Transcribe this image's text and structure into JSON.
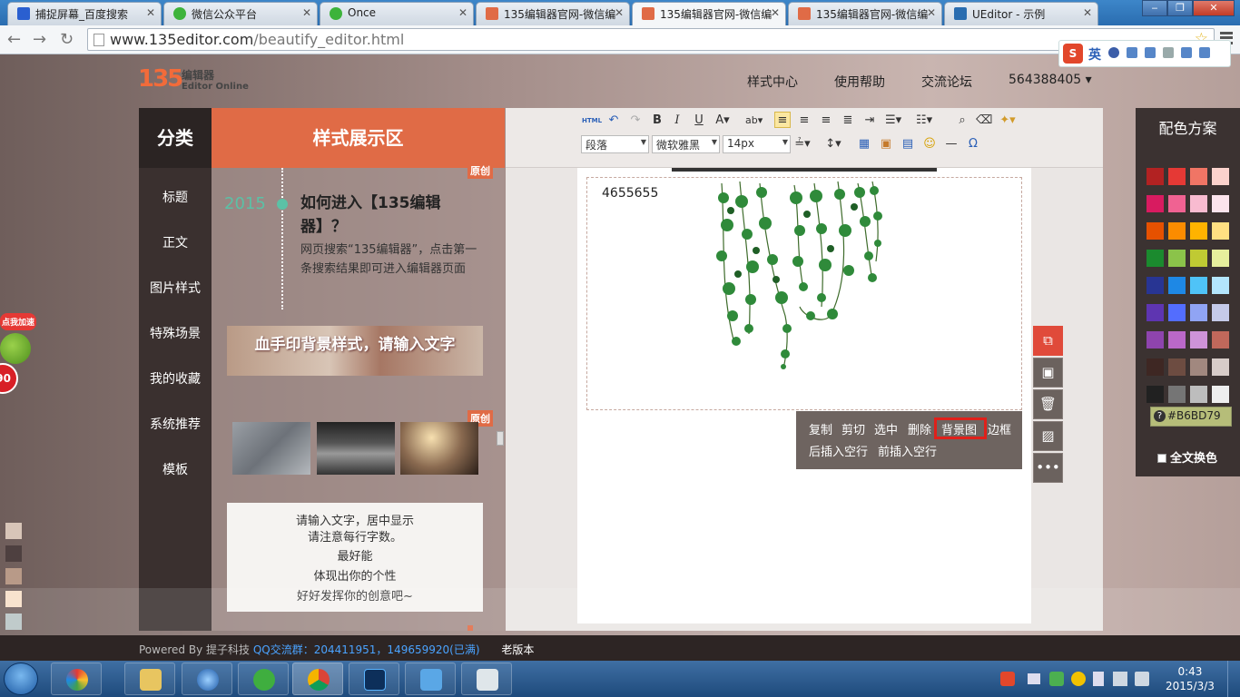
{
  "browser": {
    "tabs": [
      {
        "label": "捕捉屏幕_百度搜索",
        "fav": "#2a5fd0"
      },
      {
        "label": "微信公众平台",
        "fav": "#3db33b"
      },
      {
        "label": "Once",
        "fav": "#3db33b"
      },
      {
        "label": "135编辑器官网-微信编",
        "fav": "#e06b46"
      },
      {
        "label": "135编辑器官网-微信编",
        "fav": "#e06b46"
      },
      {
        "label": "135编辑器官网-微信编",
        "fav": "#e06b46"
      },
      {
        "label": "UEditor - 示例",
        "fav": "#2a6db0"
      }
    ],
    "url_host": "www.135editor.com",
    "url_path": "/beautify_editor.html",
    "ime": "英"
  },
  "site": {
    "logo_num": "135",
    "logo_cn": "编辑器",
    "logo_en": "Editor Online",
    "nav": [
      "样式中心",
      "使用帮助",
      "交流论坛",
      "564388405 ▾"
    ]
  },
  "categories": {
    "title": "分类",
    "items": [
      "标题",
      "正文",
      "图片样式",
      "特殊场景",
      "我的收藏",
      "系统推荐",
      "模板"
    ]
  },
  "styles": {
    "title": "样式展示区",
    "timeline_year": "2015",
    "timeline_heading": "如何进入【135编辑器】？",
    "timeline_body": "网页搜索“135编辑器”，点击第一条搜索结果即可进入编辑器页面",
    "badge": "原创",
    "banner_text": "血手印背景样式，请输入文字",
    "textbox_lines": [
      "请输入文字，居中显示",
      "请注意每行字数。",
      "最好能",
      "体现出你的个性",
      "好好发挥你的创意吧~"
    ]
  },
  "toolbar": {
    "paragraph": "段落",
    "font": "微软雅黑",
    "size": "14px"
  },
  "editor": {
    "content": "4655655"
  },
  "context_menu": {
    "copy": "复制",
    "cut": "剪切",
    "select": "选中",
    "delete": "删除",
    "background": "背景图",
    "border": "边框",
    "insert_after": "后插入空行",
    "insert_before": "前插入空行"
  },
  "color_scheme": {
    "title": "配色方案",
    "hex": "#B6BD79",
    "full_text_label": "全文换色",
    "swatches": [
      "#b22222",
      "#e53935",
      "#f07565",
      "#fbd2cc",
      "#d81b60",
      "#f06292",
      "#f8bbd0",
      "#fce4ec",
      "#e65100",
      "#fb8c00",
      "#ffb300",
      "#ffe082",
      "#1b8a2e",
      "#8bc34a",
      "#c0ca33",
      "#e6ee9c",
      "#283593",
      "#1e88e5",
      "#4fc3f7",
      "#b3e5fc",
      "#5e35b1",
      "#536dfe",
      "#90a4f4",
      "#c5cae9",
      "#8e44ad",
      "#ba68c8",
      "#ce93d8",
      "#c0685b",
      "#3e2723",
      "#6d4c41",
      "#a1887f",
      "#d7ccc8",
      "#212121",
      "#757575",
      "#bdbdbd",
      "#eeeeee"
    ]
  },
  "left_swatches": [
    "#d8c5b8",
    "#4e4040",
    "#b89a88",
    "#f7e0c8",
    "#b8c4c4"
  ],
  "badge": {
    "text": "点我加速",
    "num": "90"
  },
  "footer": {
    "powered": "Powered By 提子科技",
    "qq_label": "QQ交流群：",
    "qq_groups": "204411951，149659920(已满)",
    "old": "老版本"
  },
  "taskbar": {
    "time": "0:43",
    "date": "2015/3/3"
  }
}
